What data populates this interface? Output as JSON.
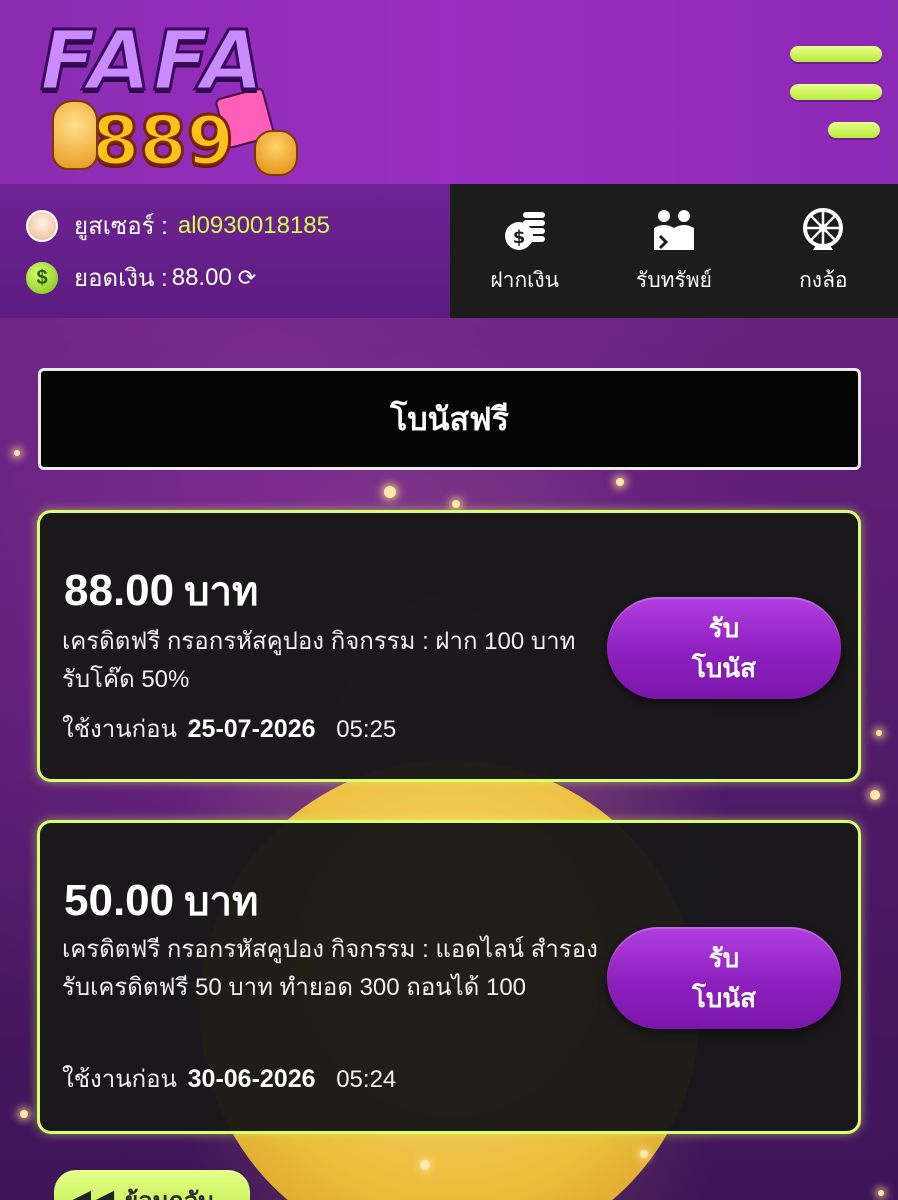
{
  "brand": {
    "logo_word": "FAFA",
    "logo_number": "889"
  },
  "user": {
    "username_label": "ยูสเซอร์ :",
    "username": "al0930018185",
    "balance_label": "ยอดเงิน :",
    "balance": "88.00",
    "coin_symbol": "$"
  },
  "actions": [
    {
      "label": "ฝากเงิน",
      "icon": "coin-stack-icon"
    },
    {
      "label": "รับทรัพย์",
      "icon": "people-icon"
    },
    {
      "label": "กงล้อ",
      "icon": "wheel-icon"
    }
  ],
  "page_title": "โบนัสฟรี",
  "bonuses": [
    {
      "amount": "88.00",
      "unit": "บาท",
      "description": "เครดิตฟรี กรอกรหัสคูปอง กิจกรรม : ฝาก 100 บาท รับโค๊ด 50%",
      "expiry_label": "ใช้งานก่อน",
      "expiry_date": "25-07-2026",
      "expiry_time": "05:25",
      "button_line1": "รับ",
      "button_line2": "โบนัส"
    },
    {
      "amount": "50.00",
      "unit": "บาท",
      "description": "เครดิตฟรี กรอกรหัสคูปอง กิจกรรม : แอดไลน์ สำรองรับเครดิตฟรี 50 บาท ทำยอด  300  ถอนได้ 100",
      "expiry_label": "ใช้งานก่อน",
      "expiry_date": "30-06-2026",
      "expiry_time": "05:24",
      "button_line1": "รับ",
      "button_line2": "โบนัส"
    }
  ],
  "back_button": "ย้อนกลับ",
  "colors": {
    "header": "#9b2ec4",
    "accent_green": "#d3ff4a",
    "button_purple": "#8e1fbf",
    "card_bg": "#181818"
  }
}
